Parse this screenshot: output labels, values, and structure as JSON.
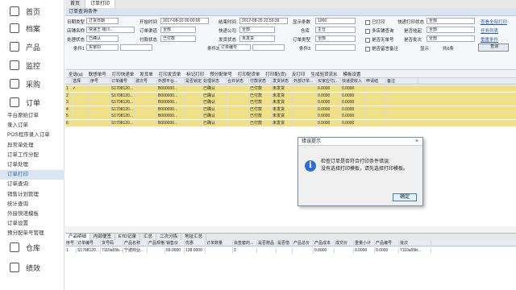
{
  "nav": {
    "items": [
      "首页",
      "档案",
      "产品",
      "监控",
      "采购",
      "订单"
    ],
    "sub": [
      "平台原始订单",
      "录入订单",
      "POS程序录入订单",
      "异常单处理",
      "订单工作分配",
      "订单处理",
      "订单打印",
      "订单查询",
      "销售计划管理",
      "统计查询",
      "外接快递模板",
      "订单设置",
      "预分配单号管理"
    ],
    "bottom": [
      "仓库",
      "绩效"
    ]
  },
  "tabs": [
    "首页",
    "订单打印"
  ],
  "panel_title": "订单查询条件",
  "filters": {
    "l1": "日期类型",
    "v1": "订货日期",
    "l2": "开始时间",
    "v2": "2017-08-10 00:00:00",
    "l3": "结束时间",
    "v3": "2017-08-25 22:59:39",
    "l4": "显示条数",
    "v4": "1000",
    "c1": "已打印",
    "l5": "快递打印状态",
    "v5": "全部",
    "l6": "店铺名称",
    "v6": "快递王·银川...",
    "l7": "订单渠道",
    "v7": "全部",
    "l8": "快递公司",
    "v8": "全部",
    "l9": "仓库",
    "v9": "主仓",
    "c2": "多店铺查询",
    "l10": "是否挂起",
    "v10": "全部",
    "l11": "处理状态",
    "v11": "已确认",
    "l12": "付款状态",
    "v12": "已付款",
    "l13": "发货状态",
    "v13": "未发货",
    "l14": "订单类型",
    "v14": "全部",
    "c3": "是否无单号",
    "l15": "是否批次",
    "v15": "全部",
    "l16": "条件1",
    "v16": "买家ID",
    "l17": "条件2",
    "v17": "订单编号",
    "l18": "条件3",
    "v18": "快递单号",
    "c4": "是否留言备注",
    "l19": "显示",
    "v19": "6 条",
    "l20": "共6条",
    "links": [
      "查看全部打印",
      "任务列表",
      "重置条件"
    ],
    "query_btn": "查询"
  },
  "toolbar": [
    "全选(a)",
    "联想单号",
    "打印快递单",
    "发货单",
    "打印发货单",
    "标记打印",
    "预分配单号",
    "打印配货单",
    "打印配(货)",
    "反打印",
    "生成验货流水",
    "模板设置"
  ],
  "columns": [
    "",
    "选择",
    "序号",
    "订单编号",
    "波次号",
    "外部平台...",
    "是否锁定",
    "处理状态",
    "合并状态",
    "付款状态",
    "发货状态",
    "外部订单...",
    "买家应付(...",
    "快递费收入",
    "申请结",
    "备注"
  ],
  "rows": [
    [
      "1",
      "✓",
      "",
      "S1708120...",
      "",
      "B000000...",
      "",
      "已确认",
      "",
      "已付款",
      "未发货",
      "",
      "0.0000",
      "0.0000",
      ""
    ],
    [
      "2",
      "",
      "",
      "S1708120...",
      "",
      "B000000...",
      "",
      "已确认",
      "",
      "已付款",
      "未发货",
      "",
      "0.0000",
      "0.0000",
      ""
    ],
    [
      "3",
      "",
      "",
      "S1708120...",
      "",
      "B000000...",
      "",
      "已确认",
      "",
      "已付款",
      "未发货",
      "",
      "0.0000",
      "0.0000",
      ""
    ],
    [
      "4",
      "",
      "",
      "S1708120...",
      "",
      "B000000...",
      "",
      "已确认",
      "",
      "已付款",
      "未发货",
      "",
      "0.0000",
      "0.0000",
      ""
    ],
    [
      "5",
      "",
      "",
      "S1708120...",
      "",
      "B000000...",
      "",
      "已确认",
      "",
      "已付款",
      "未发货",
      "",
      "0.0000",
      "0.0000",
      ""
    ],
    [
      "6",
      "",
      "",
      "S1708120...",
      "",
      "B000000...",
      "",
      "已确认",
      "",
      "已付款",
      "未发货",
      "",
      "0.0000",
      "0.0000",
      ""
    ]
  ],
  "bottom_tabs": [
    "产品明细",
    "内部便签",
    "ETD记录",
    "汇总",
    "二次分拣",
    "地址汇总"
  ],
  "bottom_cols": [
    "序号",
    "订单编号",
    "货号码",
    "产品名称",
    "产品规格",
    "销售价",
    "优惠",
    "订单数量",
    "会签套的...",
    "是否赠品",
    "是否借",
    "产品总价",
    "产品成本",
    "成交价",
    "重量小计",
    "产品编号",
    "批次"
  ],
  "bottom_row": [
    "1",
    "S1708120...",
    "7110a55b...",
    "宁波商业...",
    "",
    "69.0000",
    "138.0000",
    "",
    "2",
    "",
    "",
    "",
    "0.0000",
    "",
    "0.0000",
    "0.0000",
    "7110a55b..."
  ],
  "dialog": {
    "title": "错误提示",
    "close": "×",
    "icon": "i",
    "line1": "检查订单是否符合打印条件错误:",
    "line2": "没有选择打印模板，请先选择打印模板。",
    "ok": "确定"
  }
}
